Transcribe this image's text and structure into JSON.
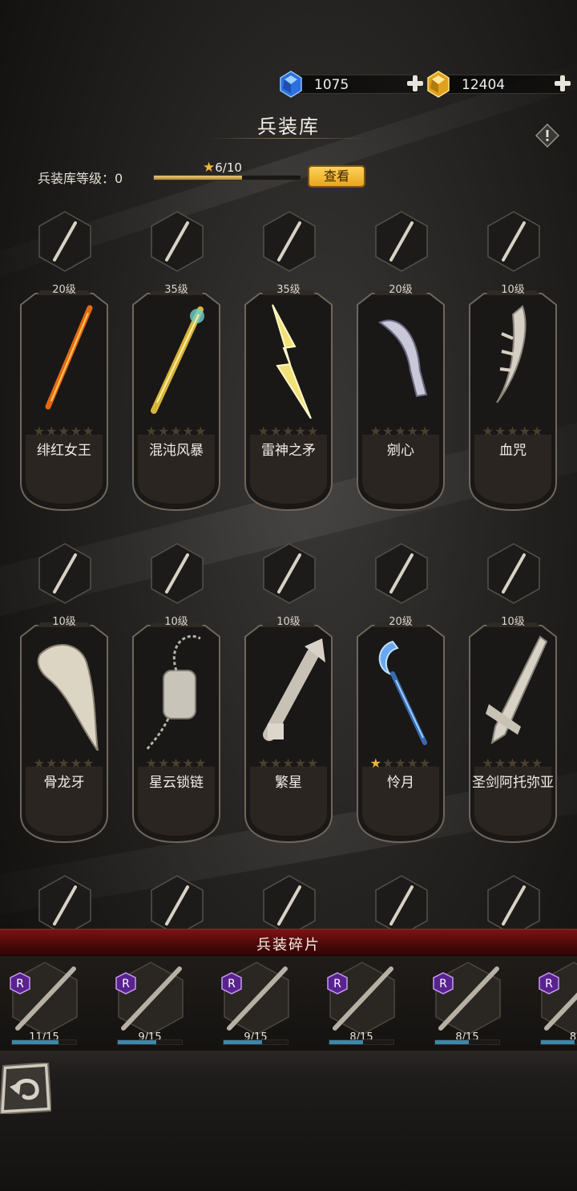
{
  "currencies": {
    "diamond": {
      "value": "1075",
      "icon": "blue-gem-icon"
    },
    "gold": {
      "value": "12404",
      "icon": "gold-gem-icon"
    }
  },
  "title": "兵装库",
  "armory": {
    "level_label": "兵装库等级：",
    "level_value": "0",
    "progress_text": "6/10",
    "progress": 0.6,
    "view_button": "查看"
  },
  "weapons": [
    {
      "name": "绯红女王",
      "level": "20级",
      "stars": 0,
      "icon": "crimson-greatsword-icon"
    },
    {
      "name": "混沌风暴",
      "level": "35级",
      "stars": 0,
      "icon": "chaos-staff-icon"
    },
    {
      "name": "雷神之矛",
      "level": "35级",
      "stars": 0,
      "icon": "lightning-spear-icon"
    },
    {
      "name": "剜心",
      "level": "20级",
      "stars": 0,
      "icon": "curved-blade-icon"
    },
    {
      "name": "血咒",
      "level": "10级",
      "stars": 0,
      "icon": "bone-sword-icon"
    },
    {
      "name": "骨龙牙",
      "level": "10级",
      "stars": 0,
      "icon": "dragon-fang-icon"
    },
    {
      "name": "星云锁链",
      "level": "10级",
      "stars": 0,
      "icon": "chain-gauntlet-icon"
    },
    {
      "name": "繁星",
      "level": "10级",
      "stars": 0,
      "icon": "gun-axe-icon"
    },
    {
      "name": "怜月",
      "level": "20级",
      "stars": 1,
      "icon": "moon-scythe-icon"
    },
    {
      "name": "圣剑阿托弥亚",
      "level": "10级",
      "stars": 0,
      "icon": "holy-sword-icon"
    }
  ],
  "row3_icons": [
    "katana-icon",
    "battle-axe-icon",
    "whip-icon",
    "cane-icon",
    "bow-icon"
  ],
  "fragments": {
    "title": "兵装碎片",
    "items": [
      {
        "rarity": "R",
        "count": "11/15",
        "progress": 0.73,
        "icon": "flintlock-pistol-icon"
      },
      {
        "rarity": "R",
        "count": "9/15",
        "progress": 0.6,
        "icon": "ice-star-mace-icon"
      },
      {
        "rarity": "R",
        "count": "9/15",
        "progress": 0.6,
        "icon": "spiked-sickle-icon"
      },
      {
        "rarity": "R",
        "count": "8/15",
        "progress": 0.53,
        "icon": "purple-katana-icon"
      },
      {
        "rarity": "R",
        "count": "8/15",
        "progress": 0.53,
        "icon": "double-axe-icon"
      },
      {
        "rarity": "R",
        "count": "8",
        "progress": 0.53,
        "icon": "branch-staff-icon"
      }
    ]
  },
  "colors": {
    "gold_button": "#f2b52c",
    "fragment_banner": "#6a1010",
    "progress_blue": "#3e87a8",
    "star_gold": "#f0b53a",
    "rarity_purple": "#6a2e9a"
  }
}
